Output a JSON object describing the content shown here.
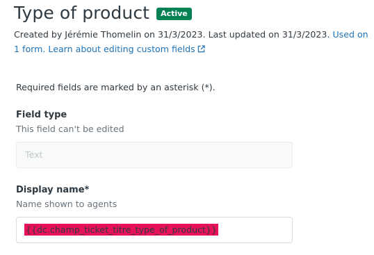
{
  "header": {
    "title": "Type of product",
    "status": "Active",
    "meta_text": "Created by Jérémie Thomelin on 31/3/2023. Last updated on 31/3/2023. ",
    "used_on_link": "Used on 1 form.",
    "learn_link": "Learn about editing custom fields",
    "learn_link_icon": "external-link-icon"
  },
  "form": {
    "required_note": "Required fields are marked by an asterisk (*).",
    "field_type": {
      "label": "Field type",
      "hint": "This field can't be edited",
      "value": "Text"
    },
    "display_name": {
      "label": "Display name*",
      "hint": "Name shown to agents",
      "value": "{{dc.champ_ticket_titre_type_of_product}}"
    }
  },
  "colors": {
    "badge": "#038153",
    "link": "#1f73b7",
    "highlight": "#e8125b"
  }
}
